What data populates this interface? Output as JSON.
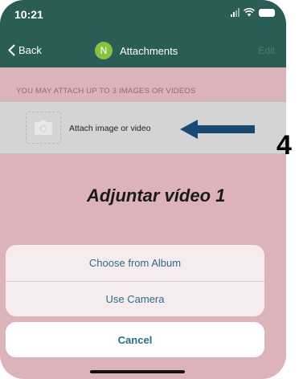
{
  "status_bar": {
    "time": "10:21"
  },
  "nav": {
    "back_label": "Back",
    "avatar_letter": "N",
    "title": "Attachments",
    "edit_label": "Edit"
  },
  "attachments": {
    "caption": "YOU MAY ATTACH UP TO 3 IMAGES OR VIDEOS",
    "attach_label": "Attach image or video"
  },
  "annotation": {
    "step_number": "4",
    "caption": "Adjuntar vídeo 1"
  },
  "action_sheet": {
    "items": [
      {
        "label": "Choose from Album"
      },
      {
        "label": "Use Camera"
      }
    ],
    "cancel_label": "Cancel"
  },
  "colors": {
    "nav_background": "#2a5d56",
    "overlay_tint": "#dcb3b8",
    "action_text": "#2b6c8a",
    "avatar": "#8bc140",
    "annotation_arrow": "#1a4a73"
  }
}
